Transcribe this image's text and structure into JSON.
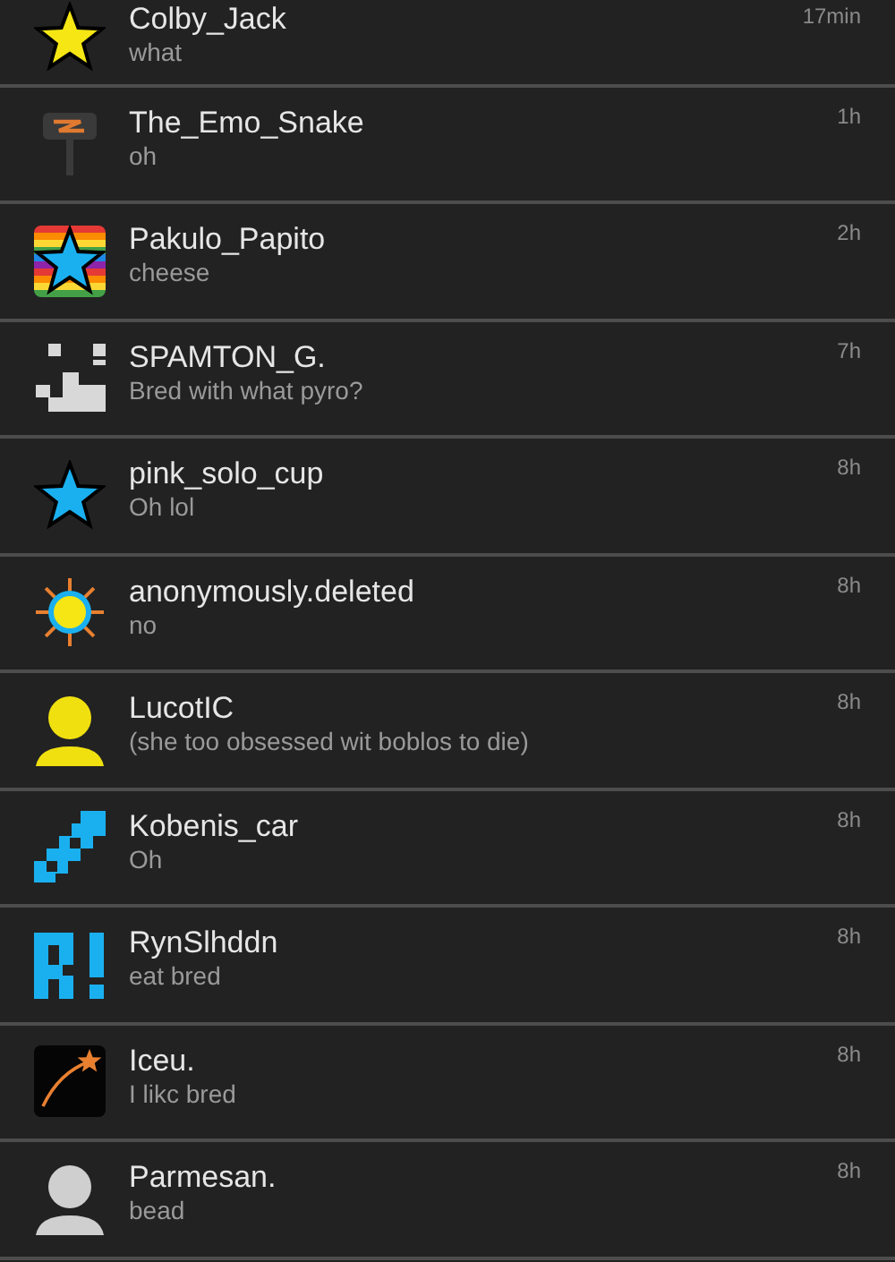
{
  "messages": [
    {
      "name": "Colby_Jack",
      "message": "what",
      "time": "17min",
      "avatar": {
        "kind": "star",
        "color": "#f5e614"
      }
    },
    {
      "name": "The_Emo_Snake",
      "message": "oh",
      "time": "1h",
      "avatar": {
        "kind": "sign"
      }
    },
    {
      "name": "Pakulo_Papito",
      "message": "cheese",
      "time": "2h",
      "avatar": {
        "kind": "rainbow-star"
      }
    },
    {
      "name": "SPAMTON_G.",
      "message": "Bred with what pyro?",
      "time": "7h",
      "avatar": {
        "kind": "pixel-face"
      }
    },
    {
      "name": "pink_solo_cup",
      "message": "Oh lol",
      "time": "8h",
      "avatar": {
        "kind": "star",
        "color": "#1ab0f0"
      }
    },
    {
      "name": "anonymously.deleted",
      "message": "no",
      "time": "8h",
      "avatar": {
        "kind": "sun"
      }
    },
    {
      "name": "LucotIC",
      "message": "(she too obsessed wit boblos to die)",
      "time": "8h",
      "avatar": {
        "kind": "person",
        "color": "#f0e010"
      }
    },
    {
      "name": "Kobenis_car",
      "message": "Oh",
      "time": "8h",
      "avatar": {
        "kind": "pixel-steps"
      }
    },
    {
      "name": "RynSlhddn",
      "message": "eat bred",
      "time": "8h",
      "avatar": {
        "kind": "pixel-r"
      }
    },
    {
      "name": "Iceu.",
      "message": "I likc bred",
      "time": "8h",
      "avatar": {
        "kind": "comet"
      }
    },
    {
      "name": "Parmesan.",
      "message": "bead",
      "time": "8h",
      "avatar": {
        "kind": "person",
        "color": "#cfcfcf"
      }
    }
  ]
}
